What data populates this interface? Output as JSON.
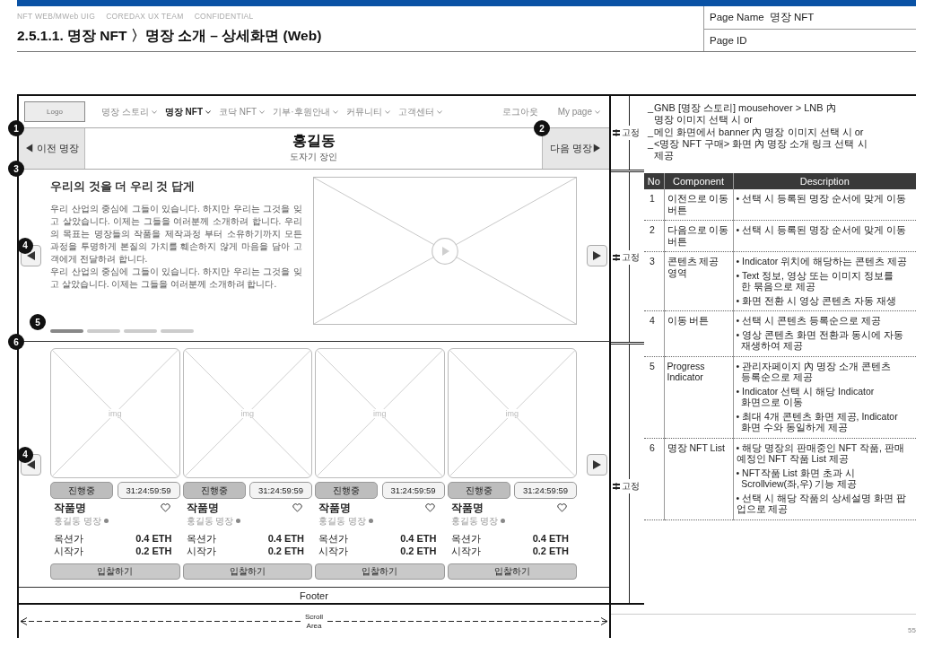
{
  "header": {
    "tags": [
      "NFT WEB/MWeb UIG",
      "COREDAX UX TEAM",
      "CONFIDENTIAL"
    ],
    "title": "2.5.1.1. 명장 NFT 〉명장 소개 – 상세화면 (Web)",
    "page_info": [
      {
        "label": "Page Name",
        "value": "명장 NFT"
      },
      {
        "label": "Page ID"
      }
    ]
  },
  "wireframe": {
    "gnb": {
      "logo": "Logo",
      "menu": [
        {
          "label": "명장 스토리",
          "selected": false
        },
        {
          "label": "명장 NFT",
          "selected": true
        },
        {
          "label": "코닥 NFT",
          "selected": false
        },
        {
          "label": "기부·후원안내",
          "selected": false
        },
        {
          "label": "커뮤니티",
          "selected": false
        },
        {
          "label": "고객센터",
          "selected": false
        }
      ],
      "utility": [
        {
          "label": "로그아웃",
          "caret": false
        },
        {
          "label": "My page",
          "caret": true
        }
      ]
    },
    "hero": {
      "prev_button": {
        "label": "◀ 이전 명장",
        "badge": "1"
      },
      "name": "홍길동",
      "role": "도자기 장인",
      "next_button": {
        "label": "다음 명장▶",
        "badge": "2"
      }
    },
    "content": {
      "badge": "3",
      "arrow_badge": "4",
      "indicator_badge": "5",
      "title": "우리의 것을 더 우리 것 답게",
      "paragraphs": [
        "우리 산업의 중심에 그들이 있습니다. 하지만 우리는 그것을 잊고 살았습니다. 이제는 그들을 여러분께 소개하려 합니다. 우리의 목표는 명장들의 작품을 제작과정 부터 소유하기까지 모든 과정을 투명하게 본질의 가치를 훼손하지 않게 마음을 담아 고객에게 전달하려 합니다.",
        "우리 산업의 중심에 그들이 있습니다. 하지만 우리는 그것을 잊고 살았습니다. 이제는 그들을 여러분께 소개하려 합니다."
      ],
      "indicators": [
        {
          "selected": true
        },
        {
          "selected": false
        },
        {
          "selected": false
        },
        {
          "selected": false
        }
      ]
    },
    "nft_list": {
      "badge": "6",
      "arrow_badge": "4",
      "cards": [
        {
          "image_label": "img",
          "status": "진행중",
          "timer": "31:24:59:59",
          "title": "작품명",
          "artist": "홍길동 명장",
          "prices": [
            {
              "label": "옥션가",
              "value": "0.4 ETH"
            },
            {
              "label": "시작가",
              "value": "0.2 ETH"
            }
          ],
          "button": "입찰하기"
        },
        {
          "image_label": "img",
          "status": "진행중",
          "timer": "31:24:59:59",
          "title": "작품명",
          "artist": "홍길동 명장",
          "prices": [
            {
              "label": "옥션가",
              "value": "0.4 ETH"
            },
            {
              "label": "시작가",
              "value": "0.2 ETH"
            }
          ],
          "button": "입찰하기"
        },
        {
          "image_label": "img",
          "status": "진행중",
          "timer": "31:24:59:59",
          "title": "작품명",
          "artist": "홍길동 명장",
          "prices": [
            {
              "label": "옥션가",
              "value": "0.4 ETH"
            },
            {
              "label": "시작가",
              "value": "0.2 ETH"
            }
          ],
          "button": "입찰하기"
        },
        {
          "image_label": "img",
          "status": "진행중",
          "timer": "31:24:59:59",
          "title": "작품명",
          "artist": "홍길동 명장",
          "prices": [
            {
              "label": "옥션가",
              "value": "0.4 ETH"
            },
            {
              "label": "시작가",
              "value": "0.2 ETH"
            }
          ],
          "button": "입찰하기"
        }
      ]
    },
    "footer": "Footer",
    "scroll_label": "Scroll Area"
  },
  "annotations": [
    {
      "label": "고정"
    },
    {
      "label": "고정"
    },
    {
      "label": "고정"
    }
  ],
  "notes": [
    {
      "marker": "_",
      "text": "GNB [명장 스토리] mousehover > LNB 內\n명장 이미지 선택 시 or"
    },
    {
      "marker": "_",
      "text": "메인 화면에서 banner 內 명장 이미지 선택 시 or"
    },
    {
      "marker": "_",
      "text": "<명장 NFT 구매> 화면 內 명장 소개 링크 선택 시\n제공"
    }
  ],
  "table": {
    "columns": [
      "No",
      "Component",
      "Description"
    ],
    "rows": [
      {
        "no": "1",
        "component": "이전으로 이동 버튼",
        "description": [
          "• 선택 시 등록된 명장 순서에 맞게 이동"
        ]
      },
      {
        "no": "2",
        "component": "다음으로 이동 버튼",
        "description": [
          "• 선택 시 등록된 명장 순서에 맞게 이동"
        ]
      },
      {
        "no": "3",
        "component": "콘텐츠 제공 영역",
        "description": [
          "• Indicator 위치에 해당하는 콘텐츠 제공",
          "• Text 정보, 영상 또는 이미지 정보를\n  한 묶음으로 제공",
          "• 화면 전환 시 영상 콘텐츠 자동 재생"
        ]
      },
      {
        "no": "4",
        "component": "이동 버튼",
        "description": [
          "• 선택 시 콘텐츠 등록순으로 제공",
          "• 영상 콘텐츠 화면 전환과 동시에 자동\n  재생하여 제공"
        ]
      },
      {
        "no": "5",
        "component": "Progress Indicator",
        "description": [
          "• 관리자페이지 內 명장 소개 콘텐츠\n  등록순으로 제공",
          "• Indicator 선택 시 해당 Indicator\n  화면으로 이동",
          "• 최대 4개 콘텐츠 화면 제공, Indicator\n  화면 수와 동일하게 제공"
        ]
      },
      {
        "no": "6",
        "component": "명장 NFT List",
        "description": [
          "• 해당 명장의 판매중인 NFT 작품, 판매\n예정인 NFT 작품 List 제공",
          "• NFT작품 List 화면 초과 시\n  Scrollview(좌,우) 기능 제공",
          "• 선택 시 해당 작품의 상세설명 화면 팝\n업으로 제공"
        ]
      }
    ]
  },
  "page_number": "55"
}
